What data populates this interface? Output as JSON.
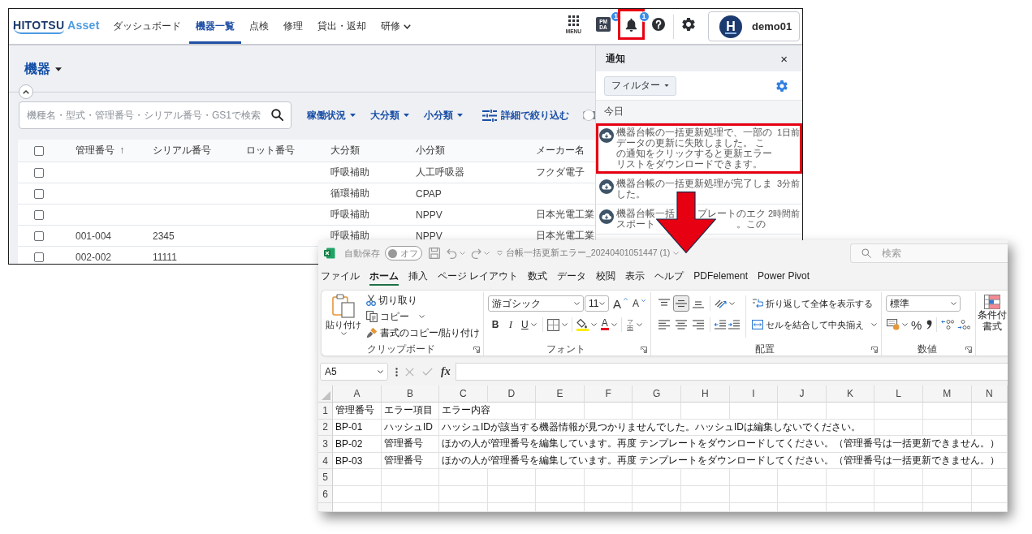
{
  "web_app": {
    "logo": {
      "primary": "HITOTSU",
      "secondary": "Asset"
    },
    "nav": [
      {
        "label": "ダッシュボード",
        "selected": false,
        "has_menu": false
      },
      {
        "label": "機器一覧",
        "selected": true,
        "has_menu": false
      },
      {
        "label": "点検",
        "selected": false,
        "has_menu": false
      },
      {
        "label": "修理",
        "selected": false,
        "has_menu": false
      },
      {
        "label": "貸出・返却",
        "selected": false,
        "has_menu": false
      },
      {
        "label": "研修",
        "selected": false,
        "has_menu": true
      }
    ],
    "header_icons": [
      {
        "kind": "menu",
        "label": "MENU",
        "highlighted": false
      },
      {
        "kind": "pmda",
        "label": "PM DA",
        "badge": "1",
        "highlighted": false
      },
      {
        "kind": "bell",
        "badge": "1",
        "highlighted": true
      },
      {
        "kind": "help",
        "highlighted": false
      },
      {
        "kind": "settings",
        "highlighted": false
      }
    ],
    "user": {
      "initial": "H",
      "name": "demo01"
    },
    "page_title": "機器",
    "search": {
      "placeholder": "機種名・型式・管理番号・シリアル番号・GS1で検索"
    },
    "filters": [
      {
        "label": "稼働状況"
      },
      {
        "label": "大分類"
      },
      {
        "label": "小分類"
      }
    ],
    "advanced_filter": {
      "label": "詳細で絞り込む"
    },
    "view_switch": {
      "on": false
    },
    "table": {
      "select_all": {
        "checked": false
      },
      "columns": [
        {
          "label": "管理番号",
          "sort_arrow": "↑"
        },
        {
          "label": "シリアル番号"
        },
        {
          "label": "ロット番号"
        },
        {
          "label": "大分類"
        },
        {
          "label": "小分類"
        },
        {
          "label": "メーカー名"
        }
      ],
      "rows": [
        {
          "checked": false,
          "category": "呼吸補助",
          "subcategory": "人工呼吸器",
          "maker": "フクダ電子"
        },
        {
          "checked": false,
          "category": "循環補助",
          "subcategory": "CPAP"
        },
        {
          "checked": false,
          "category": "呼吸補助",
          "subcategory": "NPPV",
          "maker": "日本光電工業"
        },
        {
          "checked": false,
          "management_number": "001-004",
          "serial_number": "2345",
          "category": "呼吸補助",
          "subcategory": "NPPV",
          "maker": "日本光電工業"
        },
        {
          "checked": false,
          "management_number": "002-002",
          "serial_number": "11111"
        }
      ]
    }
  },
  "notifications": {
    "title": "通知",
    "close": "×",
    "filter_label": "フィルター",
    "section": "今日",
    "items": [
      {
        "kind": "full",
        "text": "機器台帳の一括更新処理で、一部のデータの更新に失敗しました。 この通知をクリックすると更新エラーリストをダウンロードできます。",
        "time": "1日前",
        "highlighted": true
      },
      {
        "kind": "full",
        "text": "機器台帳の一括更新処理が完了しました。",
        "time": "3分前",
        "highlighted": false
      },
      {
        "kind": "partial",
        "segments": [
          [
            "機器台帳一括",
            "プレートのエク"
          ],
          [
            "スポート",
            "。この"
          ]
        ],
        "time": "2時間前",
        "highlighted": false
      }
    ]
  },
  "excel": {
    "title_bar": {
      "autosave_label": "自動保存",
      "autosave_switch": {
        "on": false,
        "label": "オフ"
      },
      "file_name": "台帳一括更新エラー_20240401051447 (1)",
      "search_placeholder": "検索"
    },
    "tabs": [
      {
        "label": "ファイル",
        "selected": false
      },
      {
        "label": "ホーム",
        "selected": true
      },
      {
        "label": "挿入",
        "selected": false
      },
      {
        "label": "ページ レイアウト",
        "selected": false
      },
      {
        "label": "数式",
        "selected": false
      },
      {
        "label": "データ",
        "selected": false
      },
      {
        "label": "校閲",
        "selected": false
      },
      {
        "label": "表示",
        "selected": false
      },
      {
        "label": "ヘルプ",
        "selected": false
      },
      {
        "label": "PDFelement",
        "selected": false
      },
      {
        "label": "Power Pivot",
        "selected": false
      }
    ],
    "ribbon": {
      "clipboard": {
        "label": "クリップボード",
        "paste": "貼り付け",
        "cut": "切り取り",
        "copy": "コピー",
        "format_painter": "書式のコピー/貼り付け"
      },
      "font": {
        "label": "フォント",
        "font_name": "游ゴシック",
        "font_size": "11",
        "grow": "A",
        "shrink": "A",
        "bold": "B",
        "italic": "I",
        "underline": "U",
        "font_color": "A"
      },
      "alignment": {
        "label": "配置",
        "vertical": [
          {
            "kind": "top",
            "selected": false
          },
          {
            "kind": "middle",
            "selected": true
          },
          {
            "kind": "bottom",
            "selected": false
          }
        ],
        "horizontal": [
          {
            "kind": "left",
            "selected": false
          },
          {
            "kind": "center",
            "selected": false
          },
          {
            "kind": "right",
            "selected": false
          }
        ],
        "wrap_text": "折り返して全体を表示する",
        "merge_center": "セルを結合して中央揃え"
      },
      "number": {
        "label": "数値",
        "format": "標準",
        "percent": "%"
      },
      "styles": {
        "conditional_formatting": [
          "条件付",
          "書式"
        ]
      }
    },
    "formula_bar": {
      "name_box": "A5",
      "function_label": "fx"
    },
    "sheet": {
      "columns": [
        "A",
        "B",
        "C",
        "D",
        "E",
        "F",
        "G",
        "H",
        "I",
        "J",
        "K",
        "L",
        "M",
        "N"
      ],
      "rows": [
        {
          "number": "1",
          "cells": [
            "管理番号",
            "エラー項目",
            "エラー内容"
          ]
        },
        {
          "number": "2",
          "cells": [
            "BP-01",
            "ハッシュID",
            "ハッシュIDが該当する機器情報が見つかりませんでした。ハッシュIDは編集しないでください。"
          ]
        },
        {
          "number": "3",
          "cells": [
            "BP-02",
            "管理番号",
            "ほかの人が管理番号を編集しています。再度 テンプレートをダウンロードしてください。（管理番号は一括更新できません。）"
          ]
        },
        {
          "number": "4",
          "cells": [
            "BP-03",
            "管理番号",
            "ほかの人が管理番号を編集しています。再度 テンプレートをダウンロードしてください。（管理番号は一括更新できません。）"
          ]
        },
        {
          "number": "5"
        },
        {
          "number": "6"
        }
      ]
    }
  }
}
